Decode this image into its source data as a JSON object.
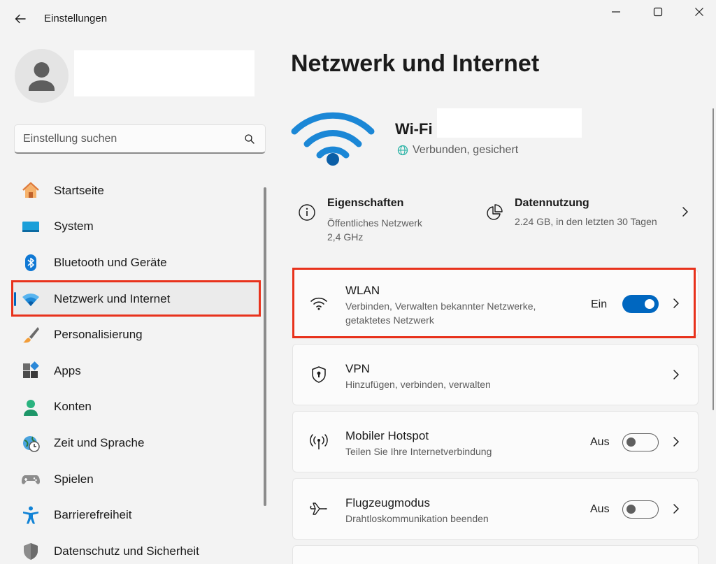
{
  "window": {
    "title": "Einstellungen",
    "back_icon": "back-arrow-icon",
    "controls": [
      "minimize-icon",
      "maximize-icon",
      "close-icon"
    ]
  },
  "search": {
    "placeholder": "Einstellung suchen",
    "icon": "search-icon"
  },
  "sidebar": {
    "items": [
      {
        "label": "Startseite",
        "icon": "home-icon"
      },
      {
        "label": "System",
        "icon": "system-display-icon"
      },
      {
        "label": "Bluetooth und Geräte",
        "icon": "bluetooth-icon"
      },
      {
        "label": "Netzwerk und Internet",
        "icon": "wifi-icon",
        "active": true
      },
      {
        "label": "Personalisierung",
        "icon": "brush-icon"
      },
      {
        "label": "Apps",
        "icon": "apps-icon"
      },
      {
        "label": "Konten",
        "icon": "account-icon"
      },
      {
        "label": "Zeit und Sprache",
        "icon": "clock-globe-icon"
      },
      {
        "label": "Spielen",
        "icon": "gamepad-icon"
      },
      {
        "label": "Barrierefreiheit",
        "icon": "accessibility-icon"
      },
      {
        "label": "Datenschutz und Sicherheit",
        "icon": "shield-icon"
      }
    ]
  },
  "main": {
    "title": "Netzwerk und Internet",
    "wifi": {
      "name_label": "Wi-Fi",
      "status": "Verbunden, gesichert"
    },
    "properties": {
      "title": "Eigenschaften",
      "line1": "Öffentliches Netzwerk",
      "line2": "2,4 GHz"
    },
    "data_usage": {
      "title": "Datennutzung",
      "sub": "2.24 GB, in den letzten 30 Tagen"
    },
    "cards": {
      "wlan": {
        "title": "WLAN",
        "sub1": "Verbinden, Verwalten bekannter Netzwerke,",
        "sub2": "getaktetes Netzwerk",
        "state": "Ein",
        "on": true
      },
      "vpn": {
        "title": "VPN",
        "sub": "Hinzufügen, verbinden, verwalten"
      },
      "hotspot": {
        "title": "Mobiler Hotspot",
        "sub": "Teilen Sie Ihre Internetverbindung",
        "state": "Aus",
        "on": false
      },
      "airplane": {
        "title": "Flugzeugmodus",
        "sub": "Drahtloskommunikation beenden",
        "state": "Aus",
        "on": false
      }
    }
  },
  "colors": {
    "accent": "#0067c0",
    "highlight": "#e8321c",
    "background": "#f3f3f3"
  }
}
